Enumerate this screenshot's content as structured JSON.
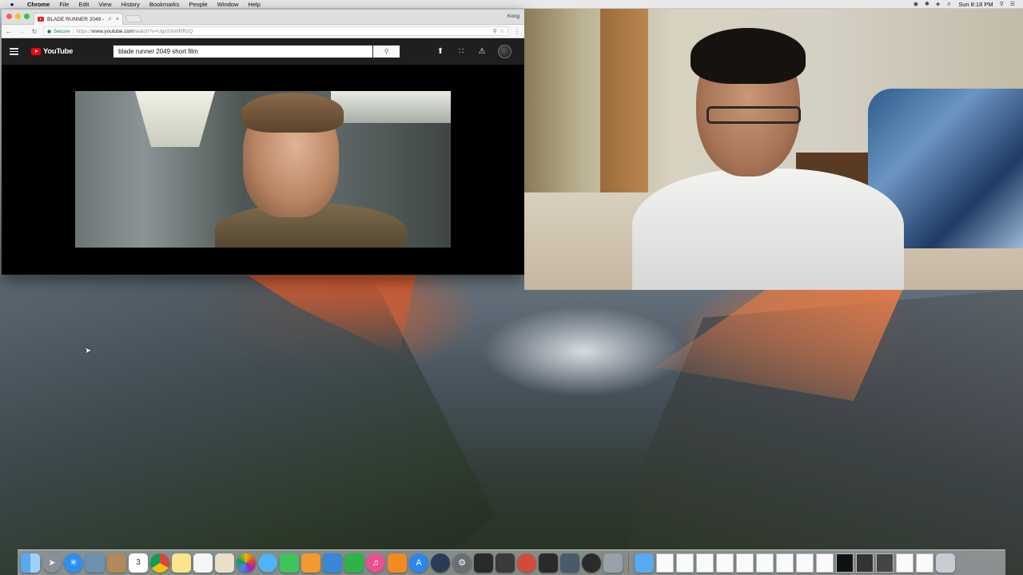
{
  "menubar": {
    "app_name": "Chrome",
    "items": [
      "File",
      "Edit",
      "View",
      "History",
      "Bookmarks",
      "People",
      "Window",
      "Help"
    ],
    "clock": "Sun 8:18 PM"
  },
  "browser": {
    "tab_title": "BLADE RUNNER 2049 - \"2",
    "profile_name": "Kong",
    "secure_label": "Secure",
    "url_scheme": "https://",
    "url_domain": "www.youtube.com",
    "url_path": "/watch?v=UgsS3nhRRzQ"
  },
  "youtube": {
    "logo_text": "YouTube",
    "search_value": "blade runner 2049 short film"
  },
  "icons": {
    "apple": "apple-icon",
    "search": "magnifier",
    "upload": "upload-arrow",
    "apps": "grid",
    "notifications": "bell"
  },
  "colors": {
    "yt_red": "#ff0000",
    "chrome_toolbar": "#f6f6f6",
    "yt_header": "#1f1f1f"
  },
  "dock": {
    "apps": [
      "Finder",
      "Launchpad",
      "Safari",
      "Preview",
      "Contacts",
      "Calendar",
      "Chrome",
      "Notes",
      "Reminders",
      "Maps",
      "Photos",
      "Messages",
      "FaceTime",
      "Pages",
      "Keynote",
      "Numbers",
      "iTunes",
      "iBooks",
      "App Store",
      "QuickTime",
      "System Preferences",
      "Final Cut Pro",
      "Motion",
      "Compressor",
      "Claquette",
      "Screenshot",
      "Trash"
    ]
  }
}
